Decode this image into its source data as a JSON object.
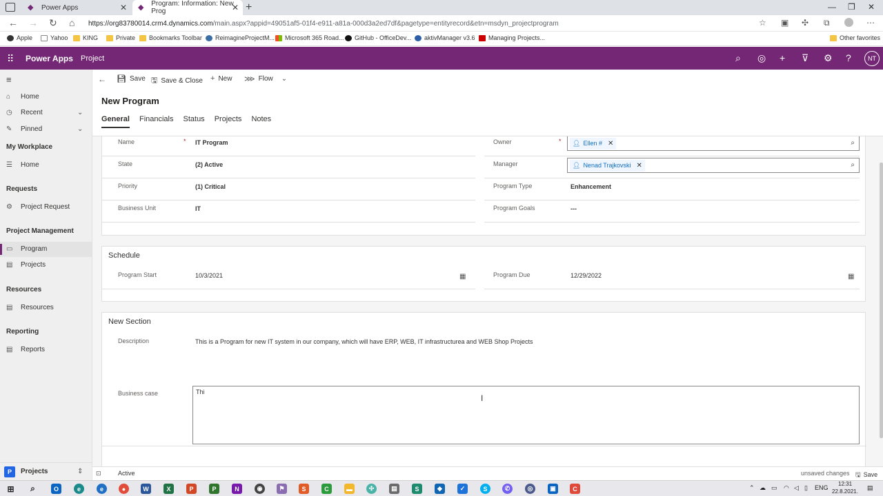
{
  "browser": {
    "tabs": [
      {
        "title": "Power Apps"
      },
      {
        "title": "Program: Information: New Prog"
      }
    ],
    "url_host": "https://org83780014.crm4.dynamics.com",
    "url_rest": "/main.aspx?appid=49051af5-01f4-e911-a81a-000d3a2ed7df&pagetype=entityrecord&etn=msdyn_projectprogram",
    "bookmarks": [
      "Apple",
      "Yahoo",
      "KING",
      "Private",
      "Bookmarks Toolbar",
      "ReimagineProjectM...",
      "Microsoft 365 Road...",
      "GitHub - OfficeDev...",
      "aktivManager v3.6",
      "Managing Projects..."
    ],
    "other_bookmarks": "Other favorites"
  },
  "app": {
    "name": "Power Apps",
    "area": "Project",
    "avatar": "NT"
  },
  "sidebar": {
    "home": "Home",
    "recent": "Recent",
    "pinned": "Pinned",
    "groups": [
      {
        "title": "My Workplace",
        "items": [
          "Home"
        ]
      },
      {
        "title": "Requests",
        "items": [
          "Project Request"
        ]
      },
      {
        "title": "Project Management",
        "items": [
          "Program",
          "Projects"
        ]
      },
      {
        "title": "Resources",
        "items": [
          "Resources"
        ]
      },
      {
        "title": "Reporting",
        "items": [
          "Reports"
        ]
      }
    ],
    "footer": {
      "badge": "P",
      "label": "Projects"
    }
  },
  "commandbar": {
    "save": "Save",
    "save_close": "Save & Close",
    "new": "New",
    "flow": "Flow"
  },
  "form": {
    "title": "New Program",
    "tabs": [
      "General",
      "Financials",
      "Status",
      "Projects",
      "Notes"
    ],
    "general": {
      "name_label": "Name",
      "name_value": "IT Program",
      "state_label": "State",
      "state_value": "(2) Active",
      "priority_label": "Priority",
      "priority_value": "(1) Critical",
      "bu_label": "Business Unit",
      "bu_value": "IT",
      "owner_label": "Owner",
      "owner_value": "Ellen #",
      "manager_label": "Manager",
      "manager_value": "Nenad Trajkovski",
      "type_label": "Program Type",
      "type_value": "Enhancement",
      "goals_label": "Program Goals",
      "goals_value": "---",
      "required_mark": "*"
    },
    "schedule": {
      "title": "Schedule",
      "start_label": "Program Start",
      "start_value": "10/3/2021",
      "due_label": "Program Due",
      "due_value": "12/29/2022"
    },
    "new_section": {
      "title": "New Section",
      "desc_label": "Description",
      "desc_value": "This is a Program for new IT system in our company, which will have ERP, WEB, IT infrastructurea and WEB Shop Projects",
      "bc_label": "Business case",
      "bc_value": "Thi"
    }
  },
  "statusbar": {
    "state": "Active",
    "unsaved": "unsaved changes",
    "save": "Save"
  },
  "taskbar": {
    "lang": "ENG",
    "time": "12:31",
    "date": "22.8.2021."
  }
}
